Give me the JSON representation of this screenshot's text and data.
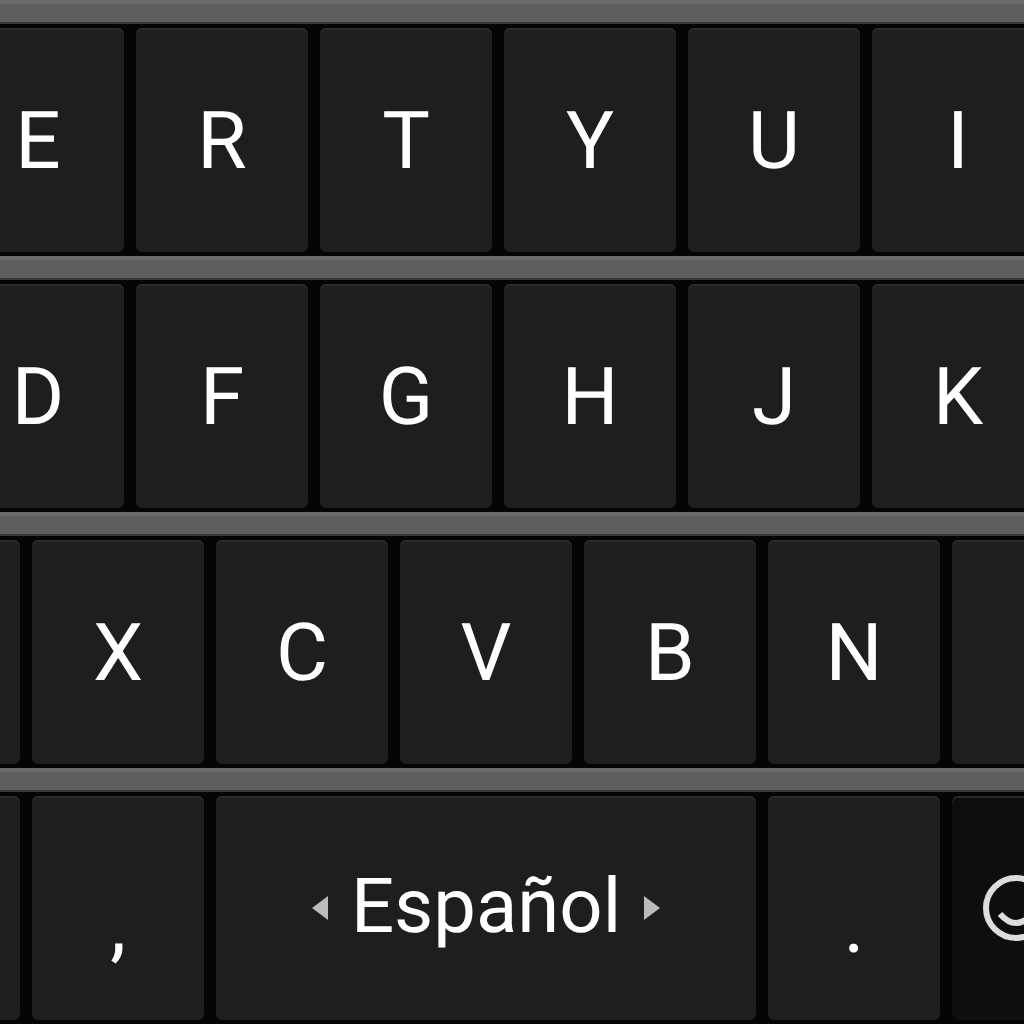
{
  "keyboard": {
    "rows": [
      {
        "keys": [
          {
            "kind": "letter",
            "label": "E"
          },
          {
            "kind": "letter",
            "label": "R"
          },
          {
            "kind": "letter",
            "label": "T"
          },
          {
            "kind": "letter",
            "label": "Y"
          },
          {
            "kind": "letter",
            "label": "U"
          },
          {
            "kind": "letter",
            "label": "I"
          }
        ]
      },
      {
        "keys": [
          {
            "kind": "letter",
            "label": "D"
          },
          {
            "kind": "letter",
            "label": "F"
          },
          {
            "kind": "letter",
            "label": "G"
          },
          {
            "kind": "letter",
            "label": "H"
          },
          {
            "kind": "letter",
            "label": "J"
          },
          {
            "kind": "letter",
            "label": "K"
          }
        ]
      },
      {
        "keys": [
          {
            "kind": "blank"
          },
          {
            "kind": "letter",
            "label": "X"
          },
          {
            "kind": "letter",
            "label": "C"
          },
          {
            "kind": "letter",
            "label": "V"
          },
          {
            "kind": "letter",
            "label": "B"
          },
          {
            "kind": "letter",
            "label": "N"
          },
          {
            "kind": "blank"
          }
        ]
      },
      {
        "keys": [
          {
            "kind": "blank"
          },
          {
            "kind": "punct",
            "label": ","
          },
          {
            "kind": "language",
            "label": "Español"
          },
          {
            "kind": "punct",
            "label": "."
          },
          {
            "kind": "emoji"
          }
        ]
      }
    ]
  }
}
